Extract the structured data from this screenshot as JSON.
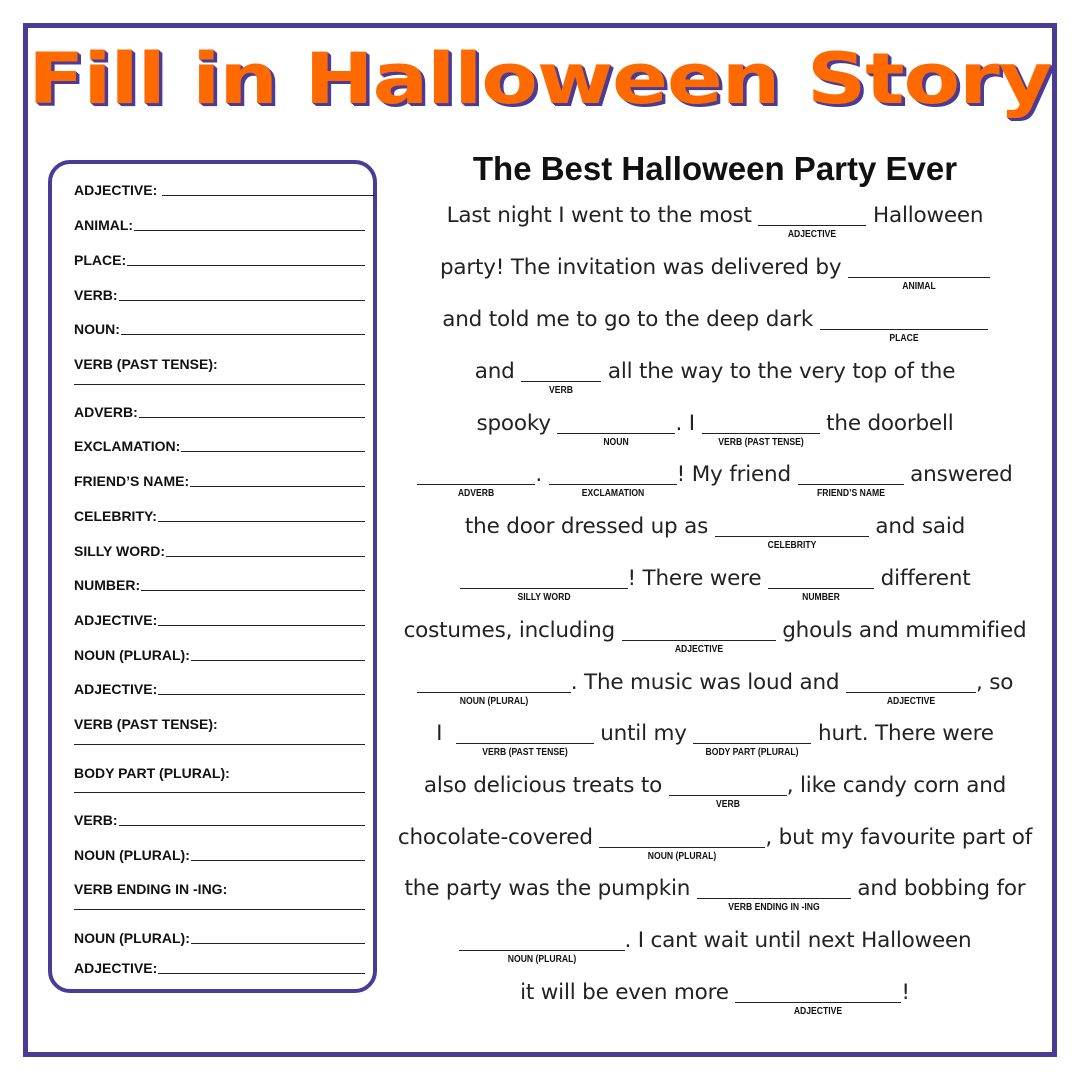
{
  "page_title": "Fill in Halloween Story",
  "colors": {
    "title_orange": "#ff6a00",
    "border_purple": "#4b3a96",
    "text": "#111111"
  },
  "word_bank": {
    "items": [
      {
        "label": "ADJECTIVE:",
        "two_line": false
      },
      {
        "label": "ANIMAL:",
        "two_line": false
      },
      {
        "label": "PLACE:",
        "two_line": false
      },
      {
        "label": "VERB:",
        "two_line": false
      },
      {
        "label": "NOUN:",
        "two_line": false
      },
      {
        "label": "VERB (PAST TENSE):",
        "two_line": true
      },
      {
        "label": "ADVERB:",
        "two_line": false
      },
      {
        "label": "EXCLAMATION:",
        "two_line": false
      },
      {
        "label": "FRIEND’S NAME:",
        "two_line": false
      },
      {
        "label": "CELEBRITY:",
        "two_line": false
      },
      {
        "label": "SILLY WORD:",
        "two_line": false
      },
      {
        "label": "NUMBER:",
        "two_line": false
      },
      {
        "label": "ADJECTIVE:",
        "two_line": false
      },
      {
        "label": "NOUN (PLURAL):",
        "two_line": false
      },
      {
        "label": "ADJECTIVE:",
        "two_line": false
      },
      {
        "label": "VERB (PAST TENSE):",
        "two_line": true
      },
      {
        "label": "BODY PART (PLURAL):",
        "two_line": true
      },
      {
        "label": "VERB:",
        "two_line": false
      },
      {
        "label": "NOUN (PLURAL):",
        "two_line": false
      },
      {
        "label": "VERB ENDING IN -ING:",
        "two_line": true
      },
      {
        "label": "NOUN (PLURAL):",
        "two_line": false
      },
      {
        "label": "ADJECTIVE:",
        "two_line": false
      }
    ]
  },
  "story": {
    "title": "The Best Halloween Party Ever",
    "lines": [
      [
        {
          "t": "Last night I went to the most "
        },
        {
          "b": "ADJECTIVE",
          "w": 108
        },
        {
          "t": " Halloween"
        }
      ],
      [
        {
          "t": "party! The invitation was delivered by "
        },
        {
          "b": "ANIMAL",
          "w": 142
        }
      ],
      [
        {
          "t": "and told me to go to the deep dark "
        },
        {
          "b": "PLACE",
          "w": 168
        }
      ],
      [
        {
          "t": "and "
        },
        {
          "b": "VERB",
          "w": 80
        },
        {
          "t": " all the way to the very top of the"
        }
      ],
      [
        {
          "t": "spooky "
        },
        {
          "b": "NOUN",
          "w": 118
        },
        {
          "t": ". I "
        },
        {
          "b": "VERB (PAST TENSE)",
          "w": 118
        },
        {
          "t": " the doorbell"
        }
      ],
      [
        {
          "b": "ADVERB",
          "w": 118
        },
        {
          "t": ". "
        },
        {
          "b": "EXCLAMATION",
          "w": 128
        },
        {
          "t": "! My friend "
        },
        {
          "b": "FRIEND’S NAME",
          "w": 106
        },
        {
          "t": " answered"
        }
      ],
      [
        {
          "t": "the door dressed up as "
        },
        {
          "b": "CELEBRITY",
          "w": 154
        },
        {
          "t": " and said"
        }
      ],
      [
        {
          "b": "SILLY WORD",
          "w": 168
        },
        {
          "t": "! There were "
        },
        {
          "b": "NUMBER",
          "w": 106
        },
        {
          "t": " different"
        }
      ],
      [
        {
          "t": "costumes, including "
        },
        {
          "b": "ADJECTIVE",
          "w": 154
        },
        {
          "t": " ghouls and mummified"
        }
      ],
      [
        {
          "b": "NOUN (PLURAL)",
          "w": 154
        },
        {
          "t": ". The music was loud and "
        },
        {
          "b": "ADJECTIVE",
          "w": 130
        },
        {
          "t": ", so"
        }
      ],
      [
        {
          "t": "I  "
        },
        {
          "b": "VERB (PAST TENSE)",
          "w": 138
        },
        {
          "t": " until my "
        },
        {
          "b": "BODY PART (PLURAL)",
          "w": 118
        },
        {
          "t": " hurt. There were"
        }
      ],
      [
        {
          "t": "also delicious treats to "
        },
        {
          "b": "VERB",
          "w": 118
        },
        {
          "t": ", like candy corn and"
        }
      ],
      [
        {
          "t": "chocolate-covered "
        },
        {
          "b": "NOUN (PLURAL)",
          "w": 166
        },
        {
          "t": ", but my favourite part of"
        }
      ],
      [
        {
          "t": "the party was the pumpkin "
        },
        {
          "b": "VERB ENDING IN -ING",
          "w": 154
        },
        {
          "t": " and bobbing for"
        }
      ],
      [
        {
          "b": "NOUN (PLURAL)",
          "w": 166
        },
        {
          "t": ". I cant wait until next Halloween"
        }
      ],
      [
        {
          "t": "it will be even more "
        },
        {
          "b": "ADJECTIVE",
          "w": 166
        },
        {
          "t": "!"
        }
      ]
    ]
  }
}
